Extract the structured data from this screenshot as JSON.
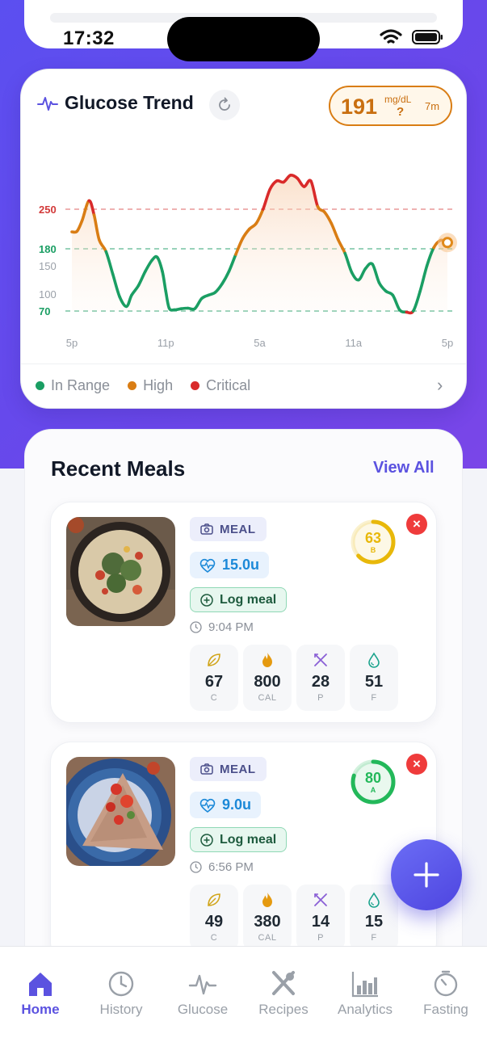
{
  "status_bar": {
    "time": "17:32"
  },
  "glucose_card": {
    "title": "Glucose Trend",
    "current_reading": {
      "value": "191",
      "unit": "mg/dL",
      "trend_symbol": "?",
      "age": "7m"
    },
    "legend": [
      {
        "label": "In Range",
        "color": "#1a9e63"
      },
      {
        "label": "High",
        "color": "#d97d14"
      },
      {
        "label": "Critical",
        "color": "#d92a2a"
      }
    ],
    "chart_data": {
      "type": "line",
      "y_axis_labels": [
        "250",
        "180",
        "150",
        "100",
        "70"
      ],
      "x_axis_labels": [
        "5p",
        "11p",
        "5a",
        "11a",
        "5p"
      ],
      "thresholds": [
        {
          "value": 250,
          "color": "#e58585"
        },
        {
          "value": 180,
          "color": "#5bb78f"
        },
        {
          "value": 70,
          "color": "#5bb78f"
        }
      ],
      "ylim": [
        40,
        310
      ],
      "x_range_hours": [
        0,
        24
      ],
      "series": [
        {
          "x": [
            0,
            0.3,
            0.6,
            1.0,
            1.3,
            1.6,
            2.0,
            2.4,
            2.8,
            3.2,
            3.5,
            3.9,
            4.3,
            4.7,
            5.0,
            5.3,
            5.5,
            5.7,
            6.0,
            6.4,
            6.8,
            7.2,
            7.6,
            8.0,
            8.4,
            8.8,
            9.2,
            9.6,
            10.0,
            10.4,
            10.8,
            11.2,
            11.6,
            12.0,
            12.4,
            12.8,
            13.2,
            13.6,
            14.0,
            14.4,
            14.8,
            15.2,
            15.6,
            16.0,
            16.4,
            16.8,
            17.2,
            17.6,
            18.0,
            18.4,
            18.8,
            19.2,
            19.6,
            20.0,
            20.4,
            20.8,
            21.2,
            21.6,
            22.0,
            22.4,
            22.8,
            23.2,
            23.6,
            24.0
          ],
          "y": [
            210,
            211,
            230,
            265,
            240,
            196,
            175,
            135,
            95,
            78,
            98,
            115,
            140,
            160,
            165,
            140,
            105,
            75,
            72,
            74,
            75,
            74,
            92,
            98,
            103,
            118,
            140,
            170,
            198,
            215,
            225,
            250,
            285,
            300,
            298,
            310,
            305,
            290,
            300,
            255,
            245,
            225,
            196,
            172,
            138,
            125,
            145,
            153,
            120,
            105,
            98,
            72,
            68,
            70,
            105,
            150,
            182,
            195,
            191
          ]
        }
      ]
    }
  },
  "meals": {
    "title": "Recent Meals",
    "view_all_label": "View All",
    "items": [
      {
        "tag": "MEAL",
        "insulin": "15.0u",
        "log_label": "Log meal",
        "time": "9:04 PM",
        "score": "63",
        "grade": "B",
        "score_color": "#e8b80a",
        "score_fraction": 0.63,
        "macros": [
          {
            "value": "67",
            "label": "C",
            "icon": "leaf-icon",
            "color": "#d1a51a"
          },
          {
            "value": "800",
            "label": "CAL",
            "icon": "flame-icon",
            "color": "#e59a10"
          },
          {
            "value": "28",
            "label": "P",
            "icon": "utensils-icon",
            "color": "#8a5fd6"
          },
          {
            "value": "51",
            "label": "F",
            "icon": "droplet-icon",
            "color": "#1aa38c"
          }
        ]
      },
      {
        "tag": "MEAL",
        "insulin": "9.0u",
        "log_label": "Log meal",
        "time": "6:56 PM",
        "score": "80",
        "grade": "A",
        "score_color": "#23b85a",
        "score_fraction": 0.8,
        "macros": [
          {
            "value": "49",
            "label": "C",
            "icon": "leaf-icon",
            "color": "#d1a51a"
          },
          {
            "value": "380",
            "label": "CAL",
            "icon": "flame-icon",
            "color": "#e59a10"
          },
          {
            "value": "14",
            "label": "P",
            "icon": "utensils-icon",
            "color": "#8a5fd6"
          },
          {
            "value": "15",
            "label": "F",
            "icon": "droplet-icon",
            "color": "#1aa38c"
          }
        ]
      }
    ]
  },
  "tabs": [
    {
      "label": "Home",
      "icon": "home-icon",
      "active": true
    },
    {
      "label": "History",
      "icon": "clock-icon",
      "active": false
    },
    {
      "label": "Glucose",
      "icon": "pulse-icon",
      "active": false
    },
    {
      "label": "Recipes",
      "icon": "utensils-cross-icon",
      "active": false
    },
    {
      "label": "Analytics",
      "icon": "bar-chart-icon",
      "active": false
    },
    {
      "label": "Fasting",
      "icon": "timer-icon",
      "active": false
    }
  ]
}
